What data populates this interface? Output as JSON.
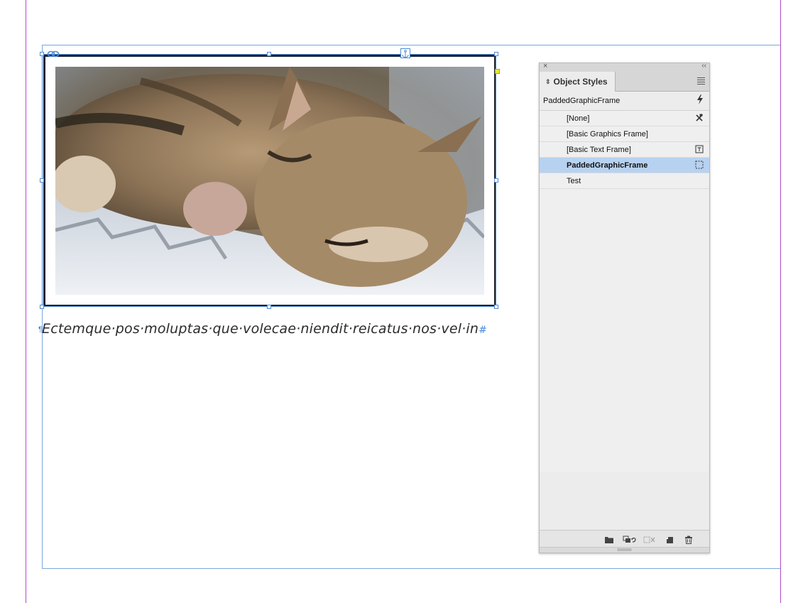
{
  "document": {
    "body_text": "Ectemque·pos·moluptas·que·volecae·niendit·reicatus·nos·vel·in",
    "paragraph_mark": "#",
    "image_subject": "tabby kitten resting on a knitted blanket"
  },
  "object_styles_panel": {
    "title": "Object Styles",
    "close_glyph": "×",
    "collapse_glyph": "‹‹",
    "current_style": "PaddedGraphicFrame",
    "styles": [
      {
        "label": "[None]",
        "icon": "clear-overrides-icon",
        "selected": false
      },
      {
        "label": "[Basic Graphics Frame]",
        "icon": "",
        "selected": false
      },
      {
        "label": "[Basic Text Frame]",
        "icon": "default-text-frame-icon",
        "selected": false
      },
      {
        "label": "PaddedGraphicFrame",
        "icon": "default-graphic-frame-icon",
        "selected": true
      },
      {
        "label": "Test",
        "icon": "",
        "selected": false
      }
    ],
    "footer_buttons": [
      "new-style-group",
      "clear-overrides",
      "clear-non-defined-attributes",
      "create-new-style",
      "delete-style"
    ]
  },
  "colors": {
    "selection_blue": "#4d8ad6",
    "selected_row": "#b7d2f0",
    "frame_stroke": "#1b2433",
    "page_guide": "#b04ac8"
  }
}
